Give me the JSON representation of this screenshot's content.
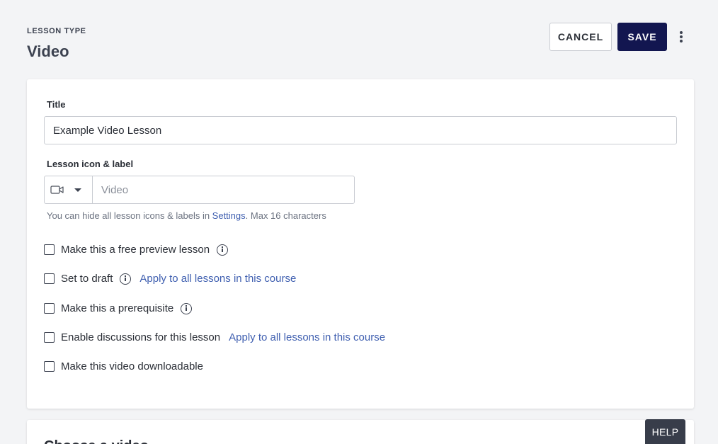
{
  "header": {
    "lesson_type_label": "LESSON TYPE",
    "lesson_type_value": "Video",
    "cancel_label": "CANCEL",
    "save_label": "SAVE"
  },
  "form": {
    "title_label": "Title",
    "title_value": "Example Video Lesson",
    "icon_label_heading": "Lesson icon & label",
    "icon_name": "video-camera-icon",
    "label_placeholder": "Video",
    "help_text_prefix": "You can hide all lesson icons & labels in ",
    "help_text_link": "Settings",
    "help_text_suffix": ". Max 16 characters",
    "options": [
      {
        "label": "Make this a free preview lesson",
        "checked": false
      },
      {
        "label": "Set to draft",
        "checked": false,
        "link": "Apply to all lessons in this course"
      },
      {
        "label": "Make this a prerequisite",
        "checked": false
      },
      {
        "label": "Enable discussions for this lesson",
        "checked": false,
        "link": "Apply to all lessons in this course"
      },
      {
        "label": "Make this video downloadable",
        "checked": false
      }
    ]
  },
  "second_card": {
    "title": "Choose a video"
  },
  "help_button": "HELP",
  "colors": {
    "primary": "#121650",
    "link": "#3f5fb0",
    "background": "#f3f4f6"
  }
}
